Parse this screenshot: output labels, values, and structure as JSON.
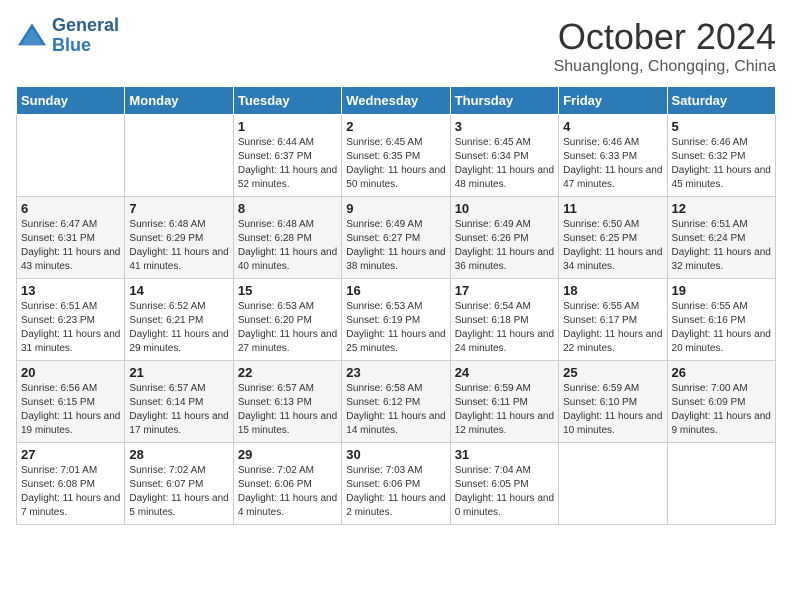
{
  "logo": {
    "line1": "General",
    "line2": "Blue"
  },
  "title": "October 2024",
  "subtitle": "Shuanglong, Chongqing, China",
  "days_header": [
    "Sunday",
    "Monday",
    "Tuesday",
    "Wednesday",
    "Thursday",
    "Friday",
    "Saturday"
  ],
  "weeks": [
    [
      {
        "day": "",
        "info": ""
      },
      {
        "day": "",
        "info": ""
      },
      {
        "day": "1",
        "info": "Sunrise: 6:44 AM\nSunset: 6:37 PM\nDaylight: 11 hours and 52 minutes."
      },
      {
        "day": "2",
        "info": "Sunrise: 6:45 AM\nSunset: 6:35 PM\nDaylight: 11 hours and 50 minutes."
      },
      {
        "day": "3",
        "info": "Sunrise: 6:45 AM\nSunset: 6:34 PM\nDaylight: 11 hours and 48 minutes."
      },
      {
        "day": "4",
        "info": "Sunrise: 6:46 AM\nSunset: 6:33 PM\nDaylight: 11 hours and 47 minutes."
      },
      {
        "day": "5",
        "info": "Sunrise: 6:46 AM\nSunset: 6:32 PM\nDaylight: 11 hours and 45 minutes."
      }
    ],
    [
      {
        "day": "6",
        "info": "Sunrise: 6:47 AM\nSunset: 6:31 PM\nDaylight: 11 hours and 43 minutes."
      },
      {
        "day": "7",
        "info": "Sunrise: 6:48 AM\nSunset: 6:29 PM\nDaylight: 11 hours and 41 minutes."
      },
      {
        "day": "8",
        "info": "Sunrise: 6:48 AM\nSunset: 6:28 PM\nDaylight: 11 hours and 40 minutes."
      },
      {
        "day": "9",
        "info": "Sunrise: 6:49 AM\nSunset: 6:27 PM\nDaylight: 11 hours and 38 minutes."
      },
      {
        "day": "10",
        "info": "Sunrise: 6:49 AM\nSunset: 6:26 PM\nDaylight: 11 hours and 36 minutes."
      },
      {
        "day": "11",
        "info": "Sunrise: 6:50 AM\nSunset: 6:25 PM\nDaylight: 11 hours and 34 minutes."
      },
      {
        "day": "12",
        "info": "Sunrise: 6:51 AM\nSunset: 6:24 PM\nDaylight: 11 hours and 32 minutes."
      }
    ],
    [
      {
        "day": "13",
        "info": "Sunrise: 6:51 AM\nSunset: 6:23 PM\nDaylight: 11 hours and 31 minutes."
      },
      {
        "day": "14",
        "info": "Sunrise: 6:52 AM\nSunset: 6:21 PM\nDaylight: 11 hours and 29 minutes."
      },
      {
        "day": "15",
        "info": "Sunrise: 6:53 AM\nSunset: 6:20 PM\nDaylight: 11 hours and 27 minutes."
      },
      {
        "day": "16",
        "info": "Sunrise: 6:53 AM\nSunset: 6:19 PM\nDaylight: 11 hours and 25 minutes."
      },
      {
        "day": "17",
        "info": "Sunrise: 6:54 AM\nSunset: 6:18 PM\nDaylight: 11 hours and 24 minutes."
      },
      {
        "day": "18",
        "info": "Sunrise: 6:55 AM\nSunset: 6:17 PM\nDaylight: 11 hours and 22 minutes."
      },
      {
        "day": "19",
        "info": "Sunrise: 6:55 AM\nSunset: 6:16 PM\nDaylight: 11 hours and 20 minutes."
      }
    ],
    [
      {
        "day": "20",
        "info": "Sunrise: 6:56 AM\nSunset: 6:15 PM\nDaylight: 11 hours and 19 minutes."
      },
      {
        "day": "21",
        "info": "Sunrise: 6:57 AM\nSunset: 6:14 PM\nDaylight: 11 hours and 17 minutes."
      },
      {
        "day": "22",
        "info": "Sunrise: 6:57 AM\nSunset: 6:13 PM\nDaylight: 11 hours and 15 minutes."
      },
      {
        "day": "23",
        "info": "Sunrise: 6:58 AM\nSunset: 6:12 PM\nDaylight: 11 hours and 14 minutes."
      },
      {
        "day": "24",
        "info": "Sunrise: 6:59 AM\nSunset: 6:11 PM\nDaylight: 11 hours and 12 minutes."
      },
      {
        "day": "25",
        "info": "Sunrise: 6:59 AM\nSunset: 6:10 PM\nDaylight: 11 hours and 10 minutes."
      },
      {
        "day": "26",
        "info": "Sunrise: 7:00 AM\nSunset: 6:09 PM\nDaylight: 11 hours and 9 minutes."
      }
    ],
    [
      {
        "day": "27",
        "info": "Sunrise: 7:01 AM\nSunset: 6:08 PM\nDaylight: 11 hours and 7 minutes."
      },
      {
        "day": "28",
        "info": "Sunrise: 7:02 AM\nSunset: 6:07 PM\nDaylight: 11 hours and 5 minutes."
      },
      {
        "day": "29",
        "info": "Sunrise: 7:02 AM\nSunset: 6:06 PM\nDaylight: 11 hours and 4 minutes."
      },
      {
        "day": "30",
        "info": "Sunrise: 7:03 AM\nSunset: 6:06 PM\nDaylight: 11 hours and 2 minutes."
      },
      {
        "day": "31",
        "info": "Sunrise: 7:04 AM\nSunset: 6:05 PM\nDaylight: 11 hours and 0 minutes."
      },
      {
        "day": "",
        "info": ""
      },
      {
        "day": "",
        "info": ""
      }
    ]
  ]
}
